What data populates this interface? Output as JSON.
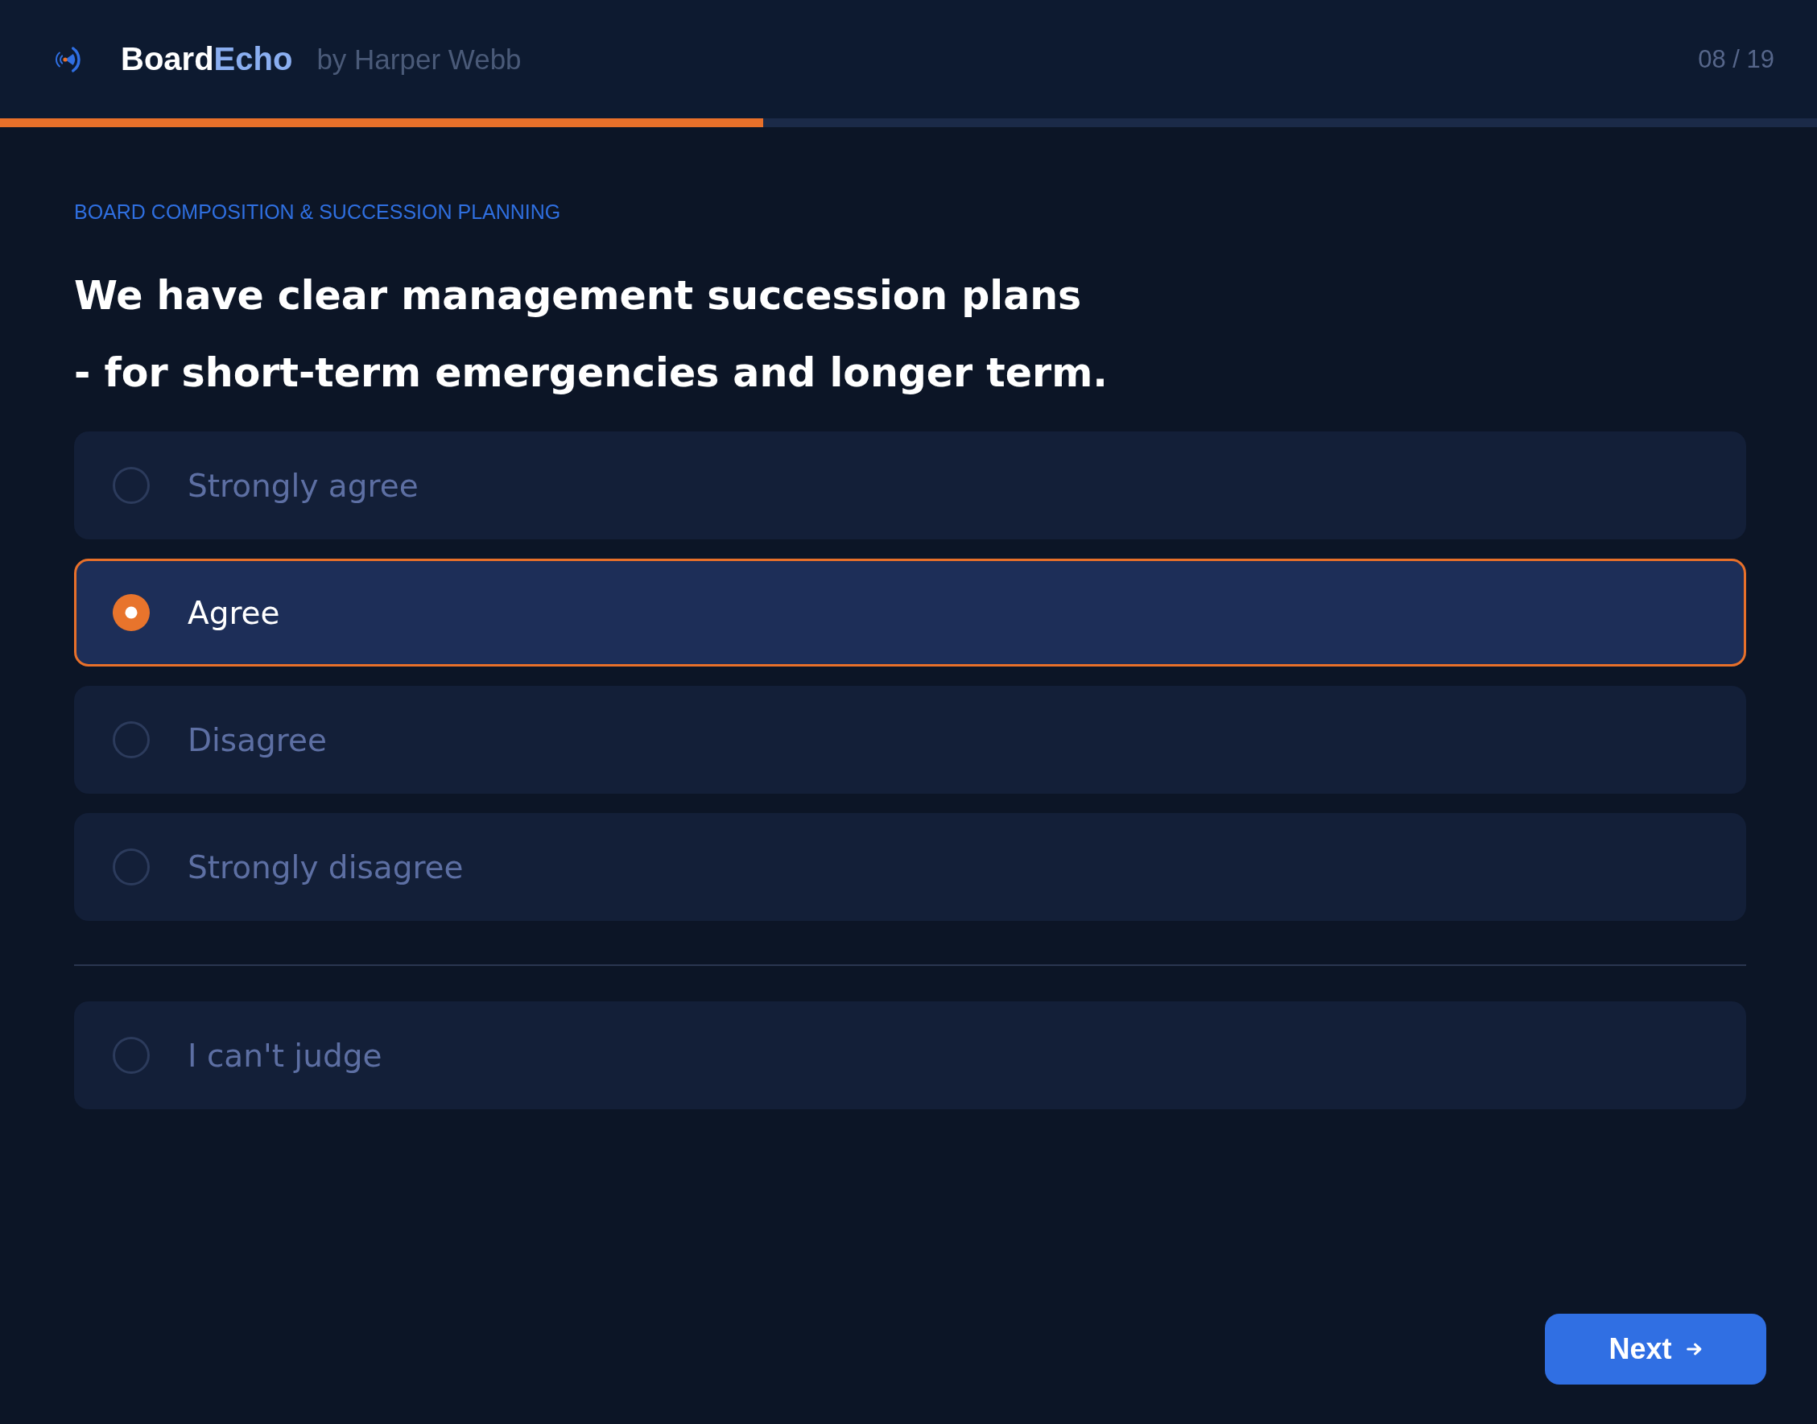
{
  "header": {
    "brand": {
      "name_main": "Board",
      "name_accent": "Echo"
    },
    "byline": "by Harper Webb",
    "counter": "08 / 19"
  },
  "progress": {
    "level": 0.42
  },
  "category": "BOARD COMPOSITION & SUCCESSION PLANNING",
  "question": "We have clear management succession plans\n- for short-term emergencies and longer term.",
  "options": [
    {
      "label": "Strongly agree",
      "selected": false
    },
    {
      "label": "Agree",
      "selected": true
    },
    {
      "label": "Disagree",
      "selected": false
    },
    {
      "label": "Strongly disagree",
      "selected": false
    }
  ],
  "opt_out_option": {
    "label": "I can't judge",
    "selected": false
  },
  "next_button": {
    "label": "Next"
  }
}
